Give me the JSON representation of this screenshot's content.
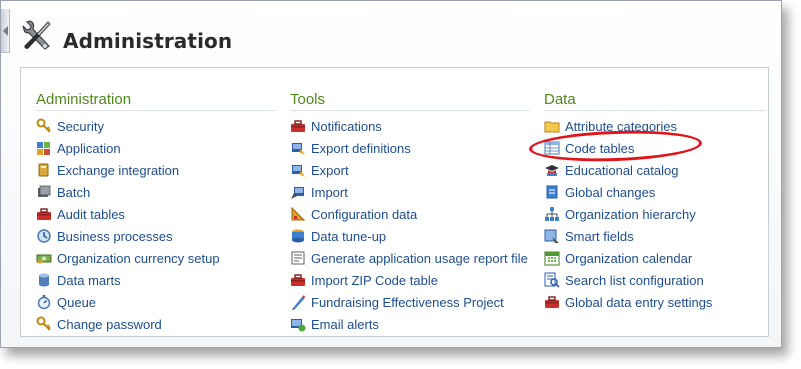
{
  "page": {
    "title": "Administration"
  },
  "columns": [
    {
      "header": "Administration",
      "items": [
        {
          "label": "Security",
          "icon": "key-icon"
        },
        {
          "label": "Application",
          "icon": "application-icon"
        },
        {
          "label": "Exchange integration",
          "icon": "exchange-icon"
        },
        {
          "label": "Batch",
          "icon": "batch-icon"
        },
        {
          "label": "Audit tables",
          "icon": "toolbox-icon"
        },
        {
          "label": "Business processes",
          "icon": "process-icon"
        },
        {
          "label": "Organization currency setup",
          "icon": "currency-icon"
        },
        {
          "label": "Data marts",
          "icon": "database-icon"
        },
        {
          "label": "Queue",
          "icon": "stopwatch-icon"
        },
        {
          "label": "Change password",
          "icon": "key-icon"
        }
      ]
    },
    {
      "header": "Tools",
      "items": [
        {
          "label": "Notifications",
          "icon": "toolbox-icon"
        },
        {
          "label": "Export definitions",
          "icon": "export-icon"
        },
        {
          "label": "Export",
          "icon": "export-icon"
        },
        {
          "label": "Import",
          "icon": "import-icon"
        },
        {
          "label": "Configuration data",
          "icon": "configuration-icon"
        },
        {
          "label": "Data tune-up",
          "icon": "tune-up-icon"
        },
        {
          "label": "Generate application usage report file",
          "icon": "report-icon"
        },
        {
          "label": "Import ZIP Code table",
          "icon": "toolbox-icon"
        },
        {
          "label": "Fundraising Effectiveness Project",
          "icon": "chart-pen-icon"
        },
        {
          "label": "Email alerts",
          "icon": "email-alert-icon"
        }
      ]
    },
    {
      "header": "Data",
      "items": [
        {
          "label": "Attribute categories",
          "icon": "folder-icon"
        },
        {
          "label": "Code tables",
          "icon": "table-icon"
        },
        {
          "label": "Educational catalog",
          "icon": "graduation-cap-icon"
        },
        {
          "label": "Global changes",
          "icon": "global-changes-icon"
        },
        {
          "label": "Organization hierarchy",
          "icon": "hierarchy-icon"
        },
        {
          "label": "Smart fields",
          "icon": "smart-fields-icon"
        },
        {
          "label": "Organization calendar",
          "icon": "calendar-icon"
        },
        {
          "label": "Search list configuration",
          "icon": "search-list-icon"
        },
        {
          "label": "Global data entry settings",
          "icon": "toolbox-icon"
        }
      ]
    }
  ],
  "annotation": {
    "highlighted_item": "Code tables",
    "ring_color": "#e0141b"
  },
  "colors": {
    "link": "#1f4e8c",
    "section_header": "#4f8a1a",
    "title": "#2b2b2b"
  }
}
